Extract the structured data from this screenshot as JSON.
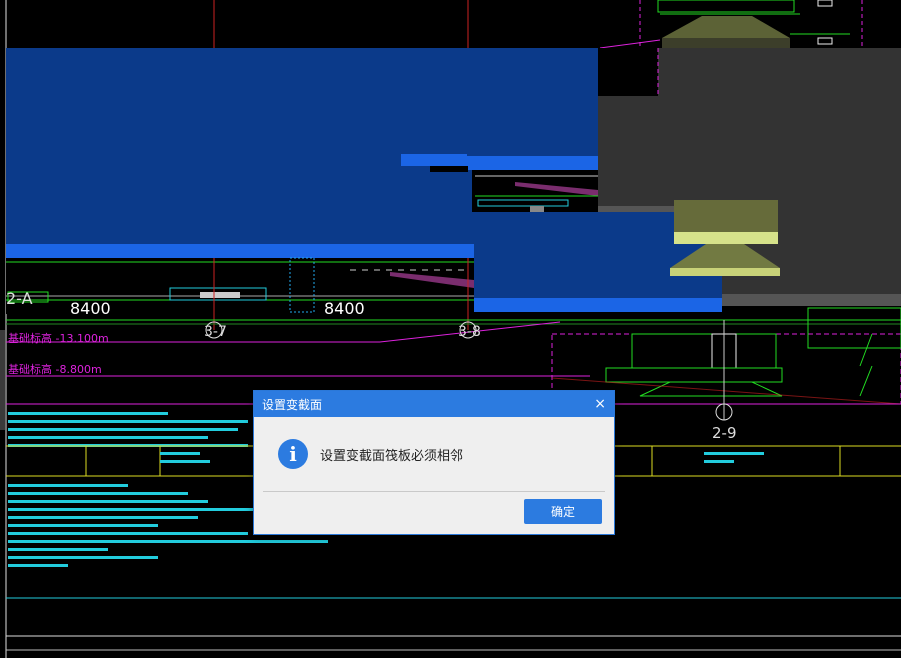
{
  "cad": {
    "span_labels": [
      "8400",
      "8400"
    ],
    "axis_labels": [
      "3-7",
      "3-8",
      "2-9",
      "2-A"
    ],
    "annotations": [
      "基础标高 -13.100m",
      "基础标高 -8.800m"
    ]
  },
  "dialog": {
    "title": "设置变截面",
    "close_glyph": "×",
    "message": "设置变截面筏板必须相邻",
    "icon_glyph": "i",
    "ok_label": "确定"
  },
  "colors": {
    "canvas_bg": "#000000",
    "slab_blue": "#0b3a8a",
    "slab_bright": "#1b65e6",
    "cad_green": "#22dd22",
    "cad_cyan": "#22ccdd",
    "cad_magenta": "#dd22dd",
    "cad_yellow": "#dddd22",
    "dialog_accent": "#2c7be0"
  }
}
